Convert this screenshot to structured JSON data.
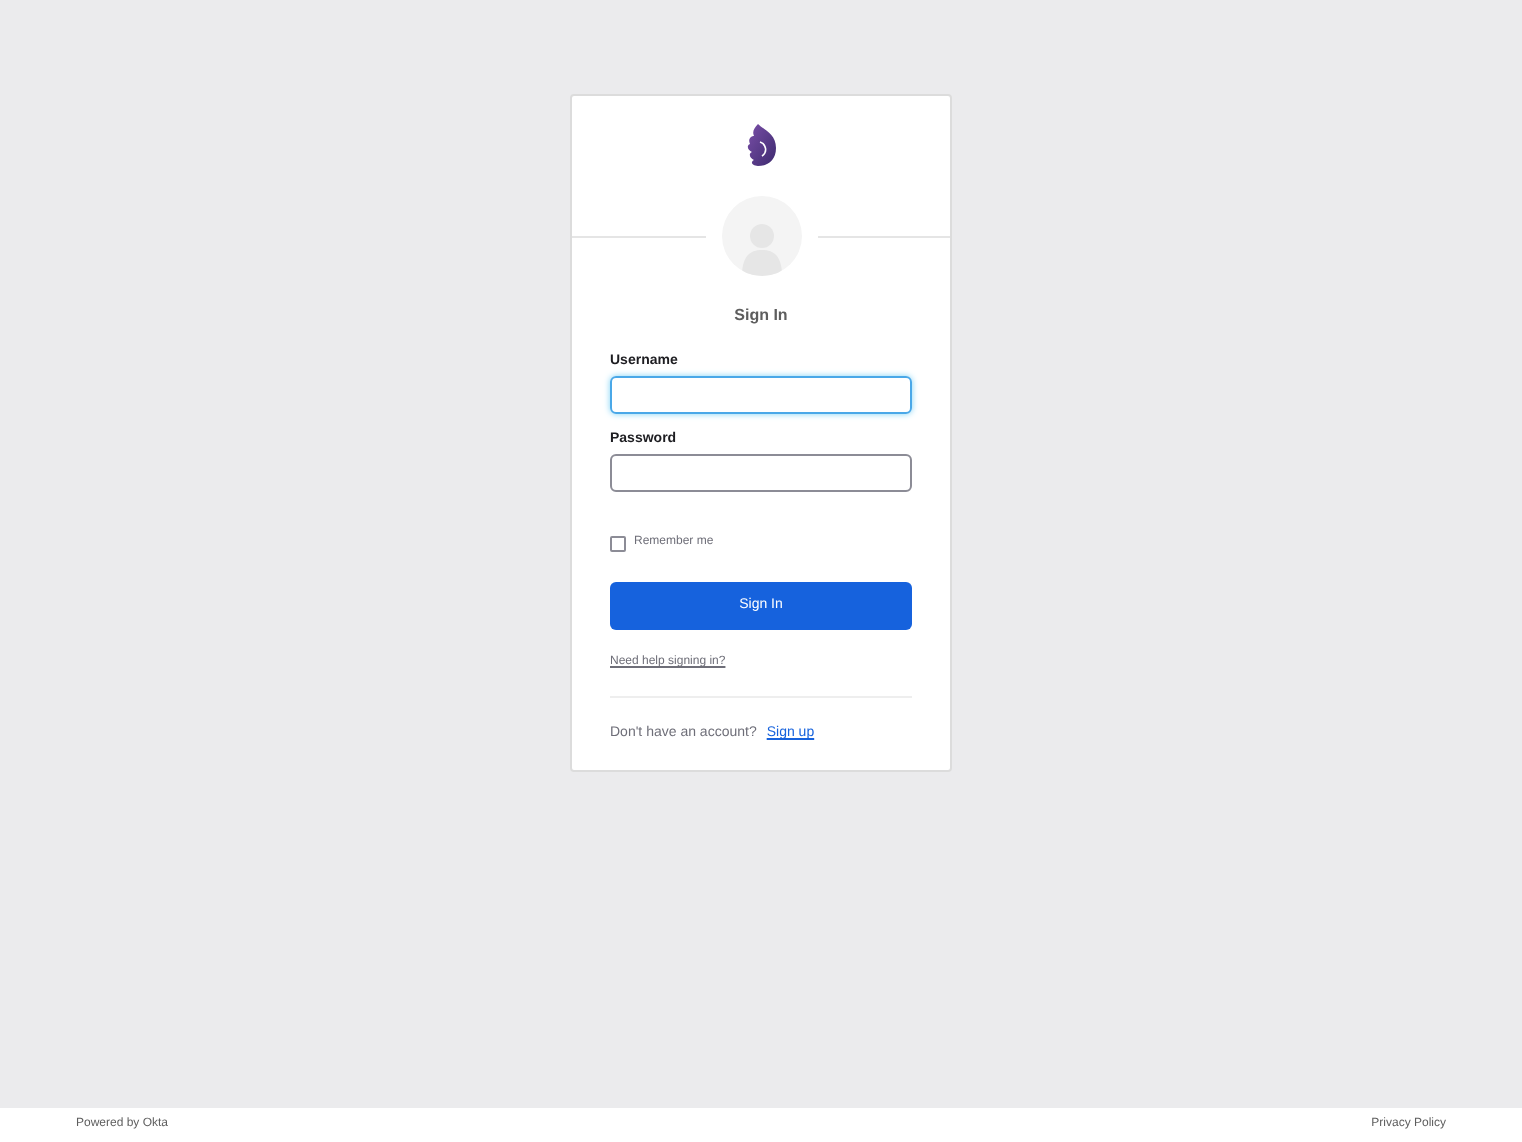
{
  "title": "Sign In",
  "fields": [
    {
      "label": "Username",
      "focused": true
    },
    {
      "label": "Password",
      "focused": false
    }
  ],
  "remember": {
    "label": "Remember me",
    "checked": false
  },
  "submit": "Sign In",
  "help_link": "Need help signing in?",
  "signup": {
    "text": "Don't have an account?",
    "link": "Sign up"
  },
  "footer": {
    "left": "Powered by Okta",
    "right": "Privacy Policy"
  }
}
